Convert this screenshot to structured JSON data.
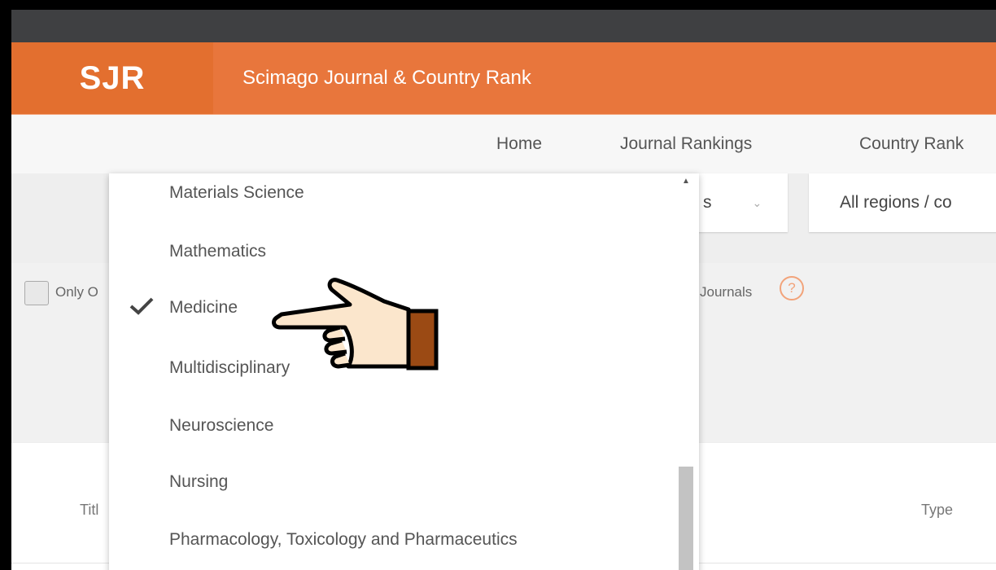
{
  "header": {
    "logo": "SJR",
    "title": "Scimago Journal & Country Rank"
  },
  "nav": {
    "items": [
      "Home",
      "Journal Rankings",
      "Country Rank"
    ],
    "active": "Journal Rankings",
    "accent_color": "#e8763c"
  },
  "filters": {
    "category_select_visible_text": "s",
    "region_select_value": "All regions / co"
  },
  "options": {
    "only_label": "Only O",
    "journals_label": "Journals",
    "help_icon_text": "?"
  },
  "dropdown": {
    "items": [
      "Materials Science",
      "Mathematics",
      "Medicine",
      "Multidisciplinary",
      "Neuroscience",
      "Nursing",
      "Pharmacology, Toxicology and Pharmaceutics"
    ],
    "selected": "Medicine"
  },
  "table": {
    "columns": [
      "Titl",
      "Type"
    ]
  },
  "icons": {
    "check": "check-icon",
    "pointer": "hand-pointer-icon",
    "chevron": "chevron-down-icon",
    "help": "question-circle-icon"
  }
}
